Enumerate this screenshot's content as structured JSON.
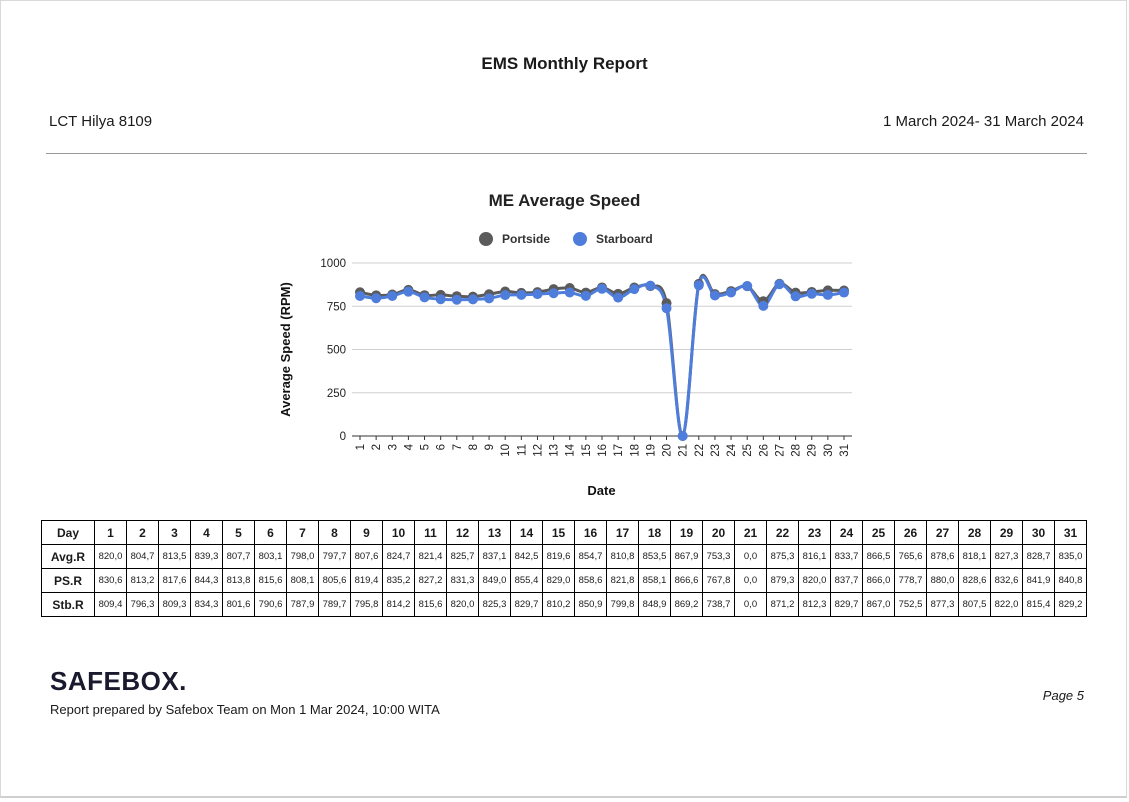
{
  "report": {
    "title": "EMS Monthly Report",
    "vessel": "LCT Hilya 8109",
    "date_range": "1 March 2024- 31 March 2024"
  },
  "chart_data": {
    "type": "line",
    "title": "ME Average Speed",
    "xlabel": "Date",
    "ylabel": "Average Speed (RPM)",
    "ylim": [
      0,
      1000
    ],
    "yticks": [
      0,
      250,
      500,
      750,
      1000
    ],
    "grid": true,
    "legend_position": "top-center",
    "categories": [
      "1",
      "2",
      "3",
      "4",
      "5",
      "6",
      "7",
      "8",
      "9",
      "10",
      "11",
      "12",
      "13",
      "14",
      "15",
      "16",
      "17",
      "18",
      "19",
      "20",
      "21",
      "22",
      "23",
      "24",
      "25",
      "26",
      "27",
      "28",
      "29",
      "30",
      "31"
    ],
    "series": [
      {
        "name": "Portside",
        "color": "#5b5b5b",
        "values": [
          830.6,
          813.2,
          817.6,
          844.3,
          813.8,
          815.6,
          808.1,
          805.6,
          819.4,
          835.2,
          827.2,
          831.3,
          849.0,
          855.4,
          829.0,
          858.6,
          821.8,
          858.1,
          866.6,
          767.8,
          0.0,
          879.3,
          820.0,
          837.7,
          866.0,
          778.7,
          880.0,
          828.6,
          832.6,
          841.9,
          840.8
        ]
      },
      {
        "name": "Starboard",
        "color": "#4f7ddc",
        "values": [
          809.4,
          796.3,
          809.3,
          834.3,
          801.6,
          790.6,
          787.9,
          789.7,
          795.8,
          814.2,
          815.6,
          820.0,
          825.3,
          829.7,
          810.2,
          850.9,
          799.8,
          848.9,
          869.2,
          738.7,
          0.0,
          871.2,
          812.3,
          829.7,
          867.0,
          752.5,
          877.3,
          807.5,
          822.0,
          815.4,
          829.2
        ]
      }
    ]
  },
  "table": {
    "header_label": "Day",
    "days": [
      "1",
      "2",
      "3",
      "4",
      "5",
      "6",
      "7",
      "8",
      "9",
      "10",
      "11",
      "12",
      "13",
      "14",
      "15",
      "16",
      "17",
      "18",
      "19",
      "20",
      "21",
      "22",
      "23",
      "24",
      "25",
      "26",
      "27",
      "28",
      "29",
      "30",
      "31"
    ],
    "rows": [
      {
        "label": "Avg.R",
        "values": [
          "820,0",
          "804,7",
          "813,5",
          "839,3",
          "807,7",
          "803,1",
          "798,0",
          "797,7",
          "807,6",
          "824,7",
          "821,4",
          "825,7",
          "837,1",
          "842,5",
          "819,6",
          "854,7",
          "810,8",
          "853,5",
          "867,9",
          "753,3",
          "0,0",
          "875,3",
          "816,1",
          "833,7",
          "866,5",
          "765,6",
          "878,6",
          "818,1",
          "827,3",
          "828,7",
          "835,0"
        ]
      },
      {
        "label": "PS.R",
        "values": [
          "830,6",
          "813,2",
          "817,6",
          "844,3",
          "813,8",
          "815,6",
          "808,1",
          "805,6",
          "819,4",
          "835,2",
          "827,2",
          "831,3",
          "849,0",
          "855,4",
          "829,0",
          "858,6",
          "821,8",
          "858,1",
          "866,6",
          "767,8",
          "0,0",
          "879,3",
          "820,0",
          "837,7",
          "866,0",
          "778,7",
          "880,0",
          "828,6",
          "832,6",
          "841,9",
          "840,8"
        ]
      },
      {
        "label": "Stb.R",
        "values": [
          "809,4",
          "796,3",
          "809,3",
          "834,3",
          "801,6",
          "790,6",
          "787,9",
          "789,7",
          "795,8",
          "814,2",
          "815,6",
          "820,0",
          "825,3",
          "829,7",
          "810,2",
          "850,9",
          "799,8",
          "848,9",
          "869,2",
          "738,7",
          "0,0",
          "871,2",
          "812,3",
          "829,7",
          "867,0",
          "752,5",
          "877,3",
          "807,5",
          "822,0",
          "815,4",
          "829,2"
        ]
      }
    ]
  },
  "footer": {
    "brand": "SAFEBOX.",
    "prepared_by": "Report prepared by Safebox Team on Mon 1 Mar 2024, 10:00 WITA",
    "page": "Page 5"
  }
}
